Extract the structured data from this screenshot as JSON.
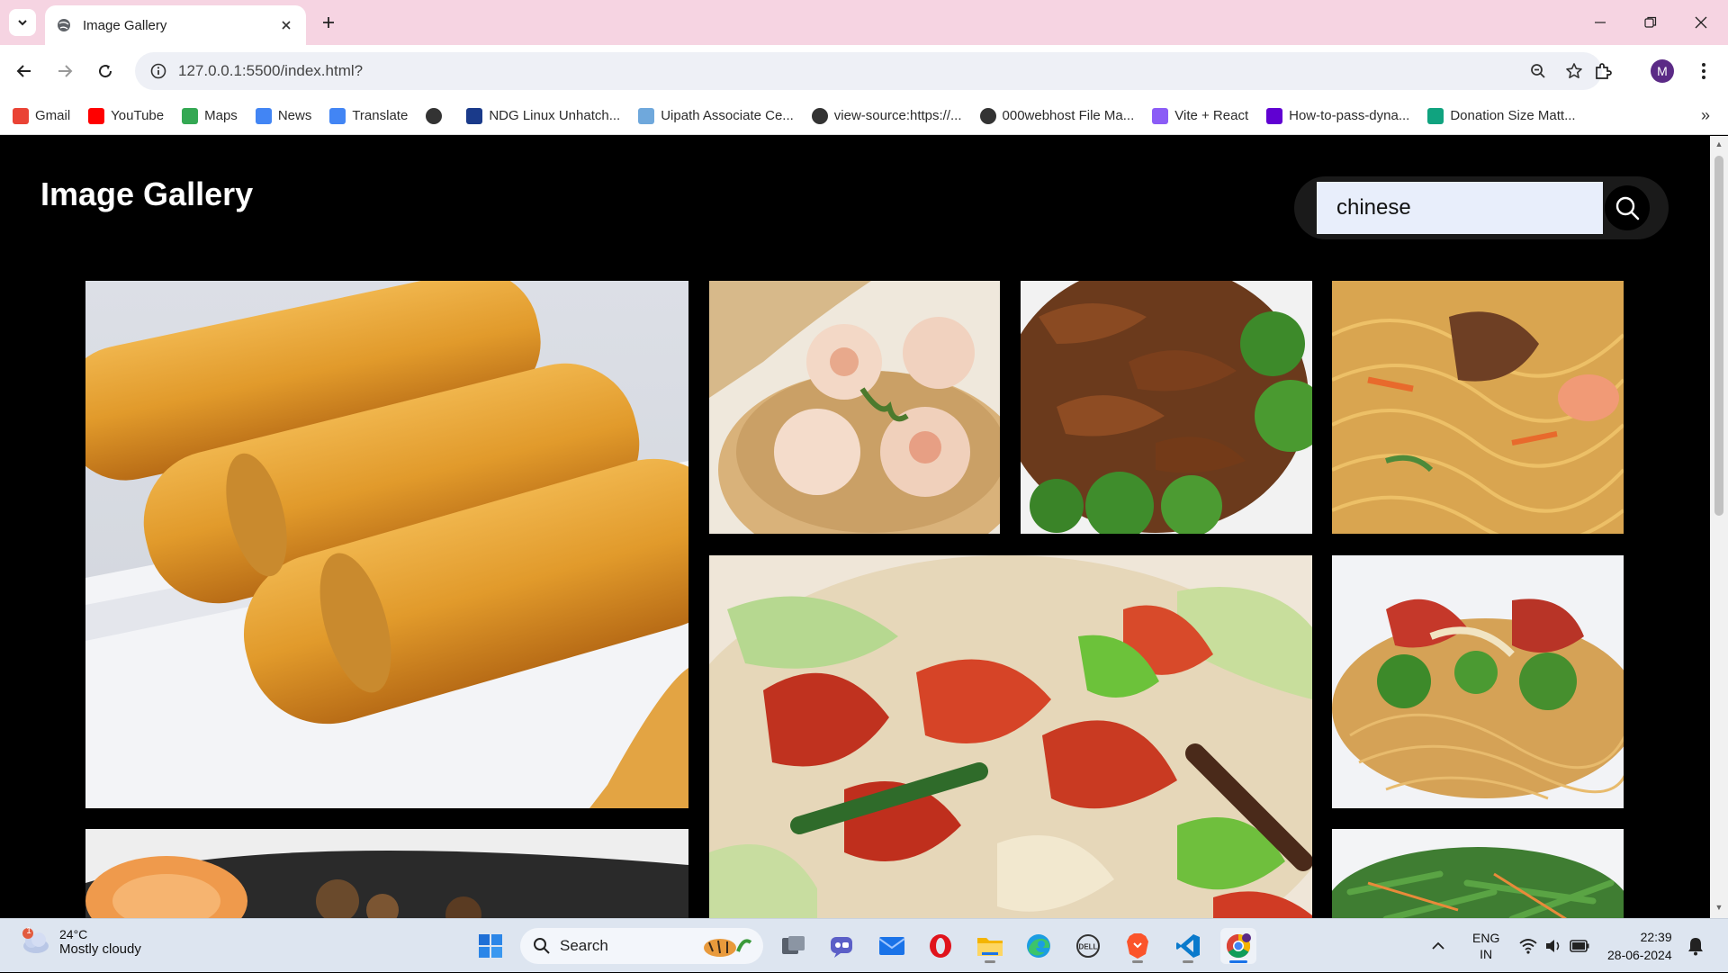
{
  "browser": {
    "tab_title": "Image Gallery",
    "url": "127.0.0.1:5500/index.html?",
    "profile_initial": "M"
  },
  "bookmarks": [
    {
      "label": "Gmail",
      "icon": "gmail-icon",
      "color": "#ea4335"
    },
    {
      "label": "YouTube",
      "icon": "youtube-icon",
      "color": "#ff0000"
    },
    {
      "label": "Maps",
      "icon": "maps-icon",
      "color": "#34a853"
    },
    {
      "label": "News",
      "icon": "news-icon",
      "color": "#4285f4"
    },
    {
      "label": "Translate",
      "icon": "translate-icon",
      "color": "#4285f4"
    },
    {
      "label": "",
      "icon": "globe-icon",
      "color": "#333333"
    },
    {
      "label": "NDG Linux Unhatch...",
      "icon": "ndg-icon",
      "color": "#1a3a8a"
    },
    {
      "label": "Uipath Associate Ce...",
      "icon": "uipath-icon",
      "color": "#6fa8dc"
    },
    {
      "label": "view-source:https://...",
      "icon": "globe-icon",
      "color": "#333333"
    },
    {
      "label": "000webhost File Ma...",
      "icon": "globe-icon",
      "color": "#333333"
    },
    {
      "label": "Vite + React",
      "icon": "vite-icon",
      "color": "#8b5cf6"
    },
    {
      "label": "How-to-pass-dyna...",
      "icon": "yahoo-icon",
      "color": "#6001d2"
    },
    {
      "label": "Donation Size Matt...",
      "icon": "chatgpt-icon",
      "color": "#10a37f"
    }
  ],
  "page": {
    "title": "Image Gallery",
    "search_value": "chinese"
  },
  "gallery": [
    {
      "name": "spring-rolls-image",
      "subject": "spring rolls"
    },
    {
      "name": "dim-sum-image",
      "subject": "dim sum"
    },
    {
      "name": "beef-broccoli-image",
      "subject": "beef and broccoli"
    },
    {
      "name": "lo-mein-image",
      "subject": "lo mein noodles"
    },
    {
      "name": "stir-fry-image",
      "subject": "stir fry"
    },
    {
      "name": "chow-mein-image",
      "subject": "chow mein"
    },
    {
      "name": "sauce-dish-image",
      "subject": "dish with sauce"
    },
    {
      "name": "green-beans-image",
      "subject": "green beans"
    }
  ],
  "taskbar": {
    "weather_badge": "1",
    "temperature": "24°C",
    "weather": "Mostly cloudy",
    "search_label": "Search",
    "lang_top": "ENG",
    "lang_bottom": "IN",
    "time": "22:39",
    "date": "28-06-2024"
  }
}
